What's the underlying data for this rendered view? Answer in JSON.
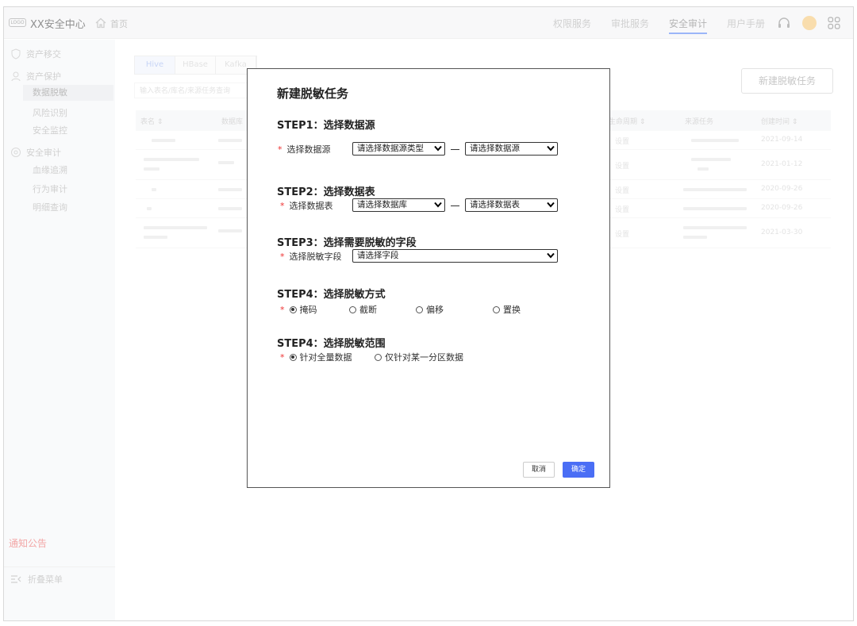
{
  "header": {
    "logo_text": "LOGO",
    "app_title": "XX安全中心",
    "home_label": "首页",
    "nav": [
      "权限服务",
      "审批服务",
      "安全审计",
      "用户手册"
    ],
    "active_nav": "安全审计"
  },
  "sidebar": {
    "groups": [
      {
        "label": "资产移交",
        "icon": "shield-icon"
      },
      {
        "label": "资产保护",
        "icon": "user-icon",
        "items": [
          "数据脱敏",
          "风险识别",
          "安全监控"
        ]
      },
      {
        "label": "安全审计",
        "icon": "gear-icon",
        "items": [
          "血缘追溯",
          "行为审计",
          "明细查询"
        ]
      }
    ],
    "active_item": "数据脱敏",
    "notice": "通知公告",
    "collapse": "折叠菜单"
  },
  "main": {
    "tabs": [
      "Hive",
      "HBase",
      "Kafka"
    ],
    "search_placeholder": "输入表名/库名/来源任务查询",
    "new_task_button": "新建脱敏任务",
    "columns": [
      "表名 ⇕",
      "数据库",
      "生命周期 ⇕",
      "来源任务",
      "创建时间 ⇕"
    ],
    "rows": [
      {
        "lifecycle": "设置",
        "created": "2021-09-14"
      },
      {
        "lifecycle": "设置",
        "created": "2021-01-12"
      },
      {
        "lifecycle": "设置",
        "created": "2020-09-26"
      },
      {
        "lifecycle": "设置",
        "created": "2020-09-26"
      },
      {
        "lifecycle": "设置",
        "created": "2021-03-30"
      }
    ]
  },
  "modal": {
    "title": "新建脱敏任务",
    "step1": {
      "title": "STEP1：选择数据源",
      "label": "选择数据源",
      "select1": "请选择数据源类型",
      "select2": "请选择数据源"
    },
    "step2": {
      "title": "STEP2：选择数据表",
      "label": "选择数据表",
      "select1": "请选择数据库",
      "select2": "请选择数据表"
    },
    "step3": {
      "title": "STEP3：选择需要脱敏的字段",
      "label": "选择脱敏字段",
      "select1": "请选择字段"
    },
    "step4": {
      "title": "STEP4：选择脱敏方式",
      "options": [
        "掩码",
        "截断",
        "偏移",
        "置换"
      ],
      "selected": "掩码"
    },
    "step5": {
      "title": "STEP4：选择脱敏范围",
      "options": [
        "针对全量数据",
        "仅针对某一分区数据"
      ],
      "selected": "针对全量数据"
    },
    "cancel": "取消",
    "confirm": "确定",
    "required_mark": "*"
  },
  "colors": {
    "accent": "#4a6ef5",
    "required": "#e33333",
    "notice": "#e85c5c",
    "avatar": "#f5c26b"
  }
}
